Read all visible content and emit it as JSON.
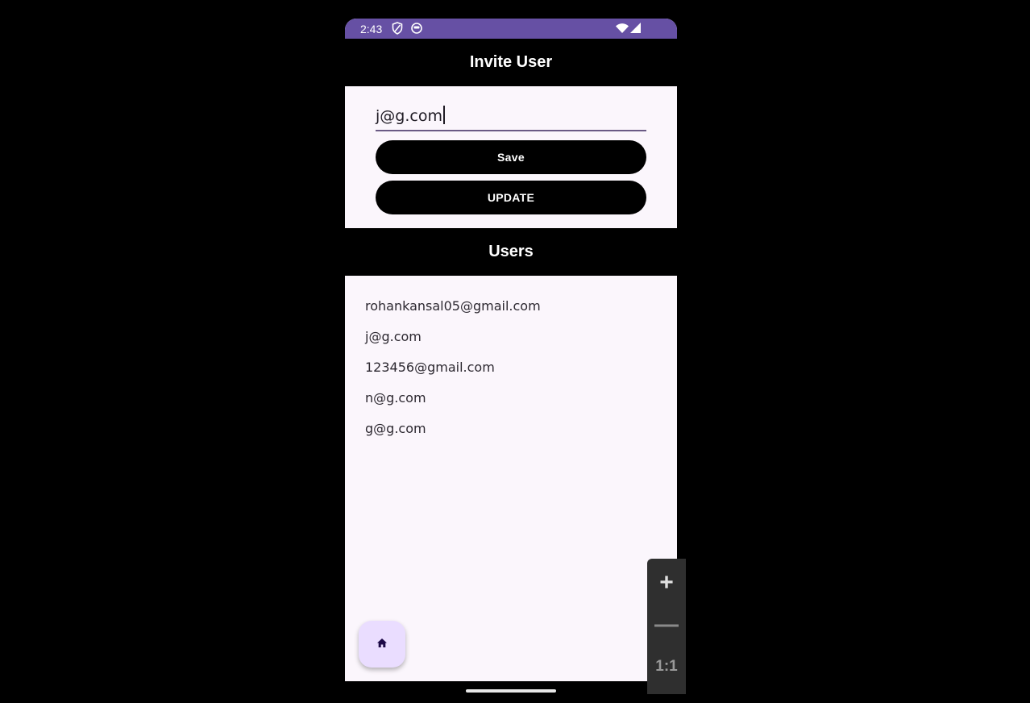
{
  "status_bar": {
    "time": "2:43",
    "left_icons": [
      "shield-icon",
      "face-icon"
    ],
    "right_icons": [
      "wifi-icon",
      "cell-signal-icon"
    ],
    "color": "#6650a4"
  },
  "invite_header": {
    "title": "Invite User"
  },
  "invite_form": {
    "email_value": "j@g.com",
    "save_label": "Save",
    "update_label": "UPDATE"
  },
  "users_header": {
    "title": "Users"
  },
  "users": [
    "rohankansal05@gmail.com",
    "j@g.com",
    "123456@gmail.com",
    "n@g.com",
    "g@g.com"
  ],
  "fab": {
    "icon": "home-icon",
    "color": "#eaddff"
  },
  "zoom_controls": {
    "zoom_in": "+",
    "zoom_out": "—",
    "reset": "1:1"
  }
}
